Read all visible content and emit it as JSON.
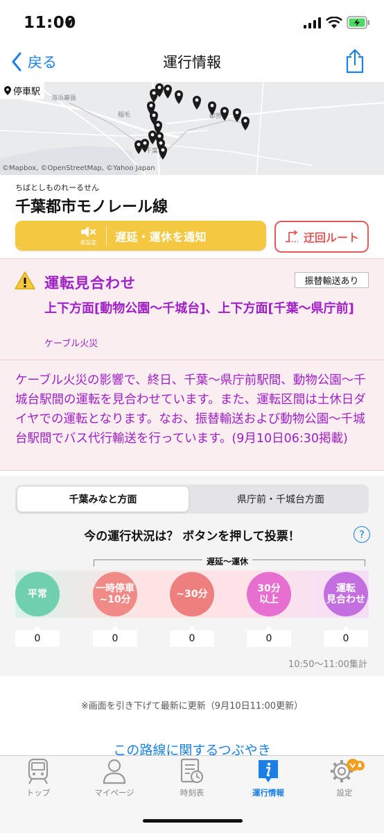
{
  "status_bar": {
    "time": "11:00"
  },
  "nav": {
    "back_label": "戻る",
    "title": "運行情報"
  },
  "map": {
    "badge": "停車駅",
    "credit": "©Mapbox, ©OpenStreetMap, ©Yahoo Japan",
    "labels": [
      "海浜幕張",
      "稲毛",
      "都賀",
      "千葉"
    ]
  },
  "line": {
    "reading": "ちばとしものれーるせん",
    "name": "千葉都市モノレール線"
  },
  "actions": {
    "notify_sub": "未設定",
    "notify_label": "遅延・運休を通知",
    "detour_label": "迂回ルート"
  },
  "alert": {
    "title": "運転見合わせ",
    "badge": "振替輸送あり",
    "section": "上下方面[動物公園〜千城台]、上下方面[千葉〜県庁前]",
    "cause": "ケーブル火災",
    "body": "ケーブル火災の影響で、終日、千葉〜県庁前駅間、動物公園〜千城台駅間の運転を見合わせています。また、運転区間は土休日ダイヤでの運転となります。なお、振替輸送および動物公園〜千城台駅間でバス代行輸送を行っています。(9月10日06:30掲載)"
  },
  "vote": {
    "tabs": [
      "千葉みなと方面",
      "県庁前・千城台方面"
    ],
    "question": "今の運行状況は？ ボタンを押して投票！",
    "help": "?",
    "bracket_label": "遅延〜運休",
    "options": [
      {
        "line1": "平常",
        "line2": "",
        "count": "0",
        "color": "#6fcfae"
      },
      {
        "line1": "一時停車",
        "line2": "~10分",
        "count": "0",
        "color": "#f08a86"
      },
      {
        "line1": "~30分",
        "line2": "",
        "count": "0",
        "color": "#ee7f7f"
      },
      {
        "line1": "30分",
        "line2": "以上",
        "count": "0",
        "color": "#e66fcf"
      },
      {
        "line1": "運転",
        "line2": "見合わせ",
        "count": "0",
        "color": "#c36fe0"
      }
    ],
    "time_range": "10:50〜11:00集計"
  },
  "update_note": "※画面を引き下げて最新に更新（9月10日11:00更新）",
  "tweets_link": "この路線に関するつぶやき",
  "tabbar": {
    "items": [
      {
        "label": "トップ",
        "icon": "train-icon"
      },
      {
        "label": "マイページ",
        "icon": "person-icon"
      },
      {
        "label": "時刻表",
        "icon": "timetable-icon"
      },
      {
        "label": "運行情報",
        "icon": "info-icon"
      },
      {
        "label": "設定",
        "icon": "gear-icon"
      }
    ]
  },
  "colors": {
    "accent": "#1a7fe6",
    "alert": "#a020c8",
    "notify": "#f5c842",
    "detour": "#e05a5a"
  }
}
